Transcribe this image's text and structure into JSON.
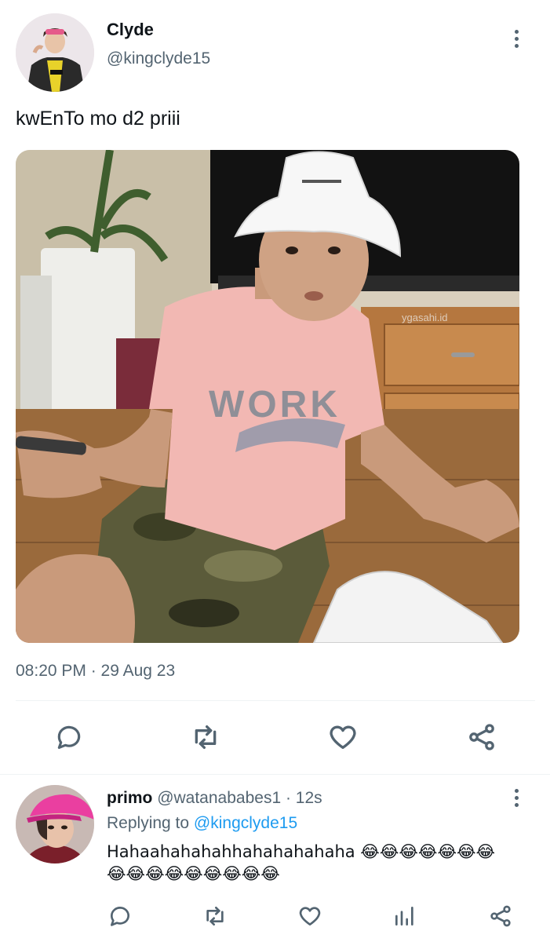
{
  "tweet": {
    "author_name": "Clyde",
    "author_handle": "@kingclyde15",
    "text": "kwEnTo mo d2 priii",
    "timestamp": "08:20 PM · 29 Aug 23",
    "image_watermark": "ygasahi.id",
    "shirt_print": "WORK",
    "actions": [
      "reply-icon",
      "retweet-icon",
      "like-icon",
      "share-icon"
    ]
  },
  "reply": {
    "author_name": "primo",
    "author_handle": "@watanababes1",
    "time": "· 12s",
    "replying_prefix": "Replying to",
    "replying_handle": "@kingclyde15",
    "text_line1": "Hahaahahahahhahahahahaha 😂😂😂😂😂😂😂",
    "text_line2": "😂😂😂😂😂😂😂😂😂",
    "actions": [
      "reply-icon",
      "retweet-icon",
      "like-icon",
      "views-icon",
      "share-icon"
    ]
  },
  "colors": {
    "text": "#0f1419",
    "muted": "#536471",
    "link": "#1d9bf0",
    "divider": "#eff3f4"
  }
}
